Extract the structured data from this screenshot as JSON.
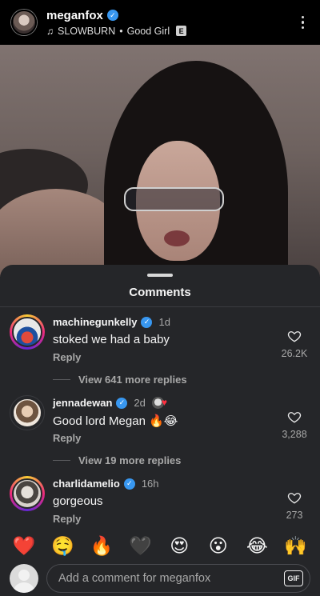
{
  "post": {
    "username": "meganfox",
    "audio_artist": "SLOWBURN",
    "audio_separator": "•",
    "audio_track": "Good Girl",
    "explicit_badge": "E"
  },
  "sheet": {
    "title": "Comments"
  },
  "comments": [
    {
      "username": "machinegunkelly",
      "time": "1d",
      "text": "stoked we had a baby",
      "reply_label": "Reply",
      "likes": "26.2K",
      "view_more": "View 641 more replies",
      "story_ring": true
    },
    {
      "username": "jennadewan",
      "time": "2d",
      "text": "Good lord Megan 🔥😂",
      "reply_label": "Reply",
      "likes": "3,288",
      "view_more": "View 19 more replies",
      "story_ring": false,
      "liked_by_author": true
    },
    {
      "username": "charlidamelio",
      "time": "16h",
      "text": "gorgeous",
      "reply_label": "Reply",
      "likes": "273",
      "story_ring": true
    }
  ],
  "emoji_bar": [
    "❤️",
    "🤤",
    "🔥",
    "🖤",
    "😍",
    "😮",
    "😂",
    "🙌"
  ],
  "composer": {
    "placeholder": "Add a comment for meganfox",
    "gif_label": "GIF"
  },
  "colors": {
    "sheet_bg": "#252629",
    "verified": "#3897f0",
    "secondary_text": "#a8a8a8"
  },
  "icons": {
    "verified": "verified-badge-icon",
    "audio": "music-note-icon",
    "more": "kebab-menu-icon",
    "like": "heart-outline-icon",
    "gif": "gif-icon"
  }
}
